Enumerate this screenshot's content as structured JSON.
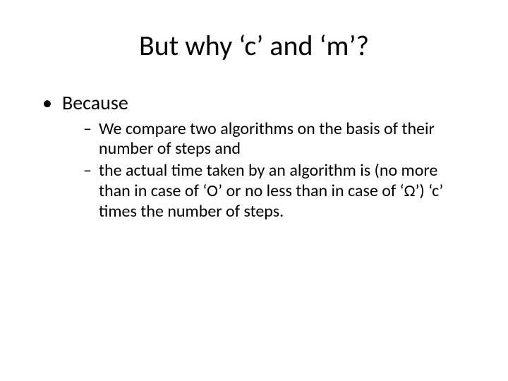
{
  "slide": {
    "title": "But why ‘c’ and ‘m’?",
    "bullets": [
      {
        "text": "Because",
        "children": [
          "We compare two algorithms on the basis of their number of steps and",
          "the actual time taken by an algorithm is (no more than in case of  ‘O’ or no less than in case of ‘Ω’) ‘c’ times the number of steps."
        ]
      }
    ]
  }
}
